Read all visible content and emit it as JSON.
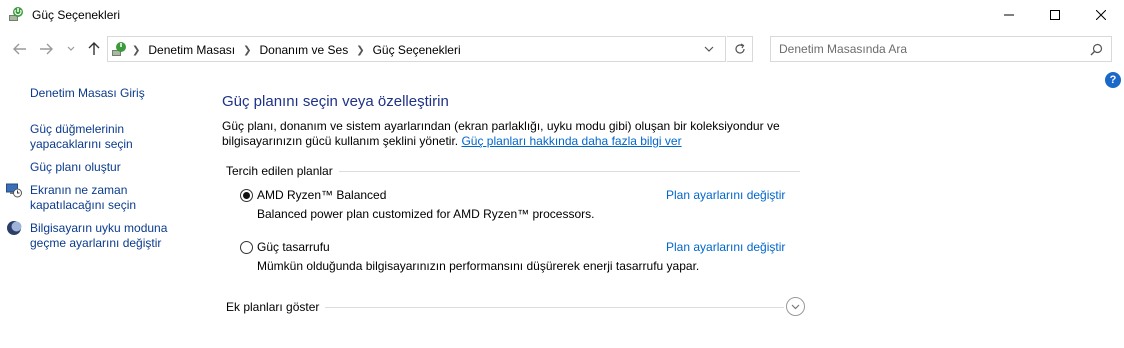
{
  "window": {
    "title": "Güç Seçenekleri"
  },
  "nav": {
    "breadcrumbs": [
      "Denetim Masası",
      "Donanım ve Ses",
      "Güç Seçenekleri"
    ],
    "search_placeholder": "Denetim Masasında Ara"
  },
  "help": {
    "label": "?"
  },
  "sidebar": {
    "home": "Denetim Masası Giriş",
    "items": [
      {
        "label_line1": "Güç düğmelerinin",
        "label_line2": "yapacaklarını seçin",
        "icon": "none"
      },
      {
        "label_line1": "Güç planı oluştur",
        "label_line2": "",
        "icon": "none"
      },
      {
        "label_line1": "Ekranın ne zaman",
        "label_line2": "kapatılacağını seçin",
        "icon": "monitor-clock-icon"
      },
      {
        "label_line1": "Bilgisayarın uyku moduna",
        "label_line2": "geçme ayarlarını değiştir",
        "icon": "moon-icon"
      }
    ]
  },
  "main": {
    "title": "Güç planını seçin veya özelleştirin",
    "description": "Güç planı, donanım ve sistem ayarlarından (ekran parlaklığı, uyku modu gibi) oluşan bir koleksiyondur ve bilgisayarınızın gücü kullanım şeklini yönetir.",
    "learn_more_link": "Güç planları hakkında daha fazla bilgi ver",
    "preferred_header": "Tercih edilen planlar",
    "plans": [
      {
        "name": "AMD Ryzen™ Balanced",
        "description": "Balanced power plan customized for AMD Ryzen™ processors.",
        "link": "Plan ayarlarını değiştir",
        "selected": true
      },
      {
        "name": "Güç tasarrufu",
        "description": "Mümkün olduğunda bilgisayarınızın performansını düşürerek enerji tasarrufu yapar.",
        "link": "Plan ayarlarını değiştir",
        "selected": false
      }
    ],
    "more_plans_label": "Ek planları göster"
  },
  "colors": {
    "link": "#0066cc",
    "sidebar_link": "#0b3b8c",
    "title": "#1e3287",
    "help": "#1a68c7"
  }
}
